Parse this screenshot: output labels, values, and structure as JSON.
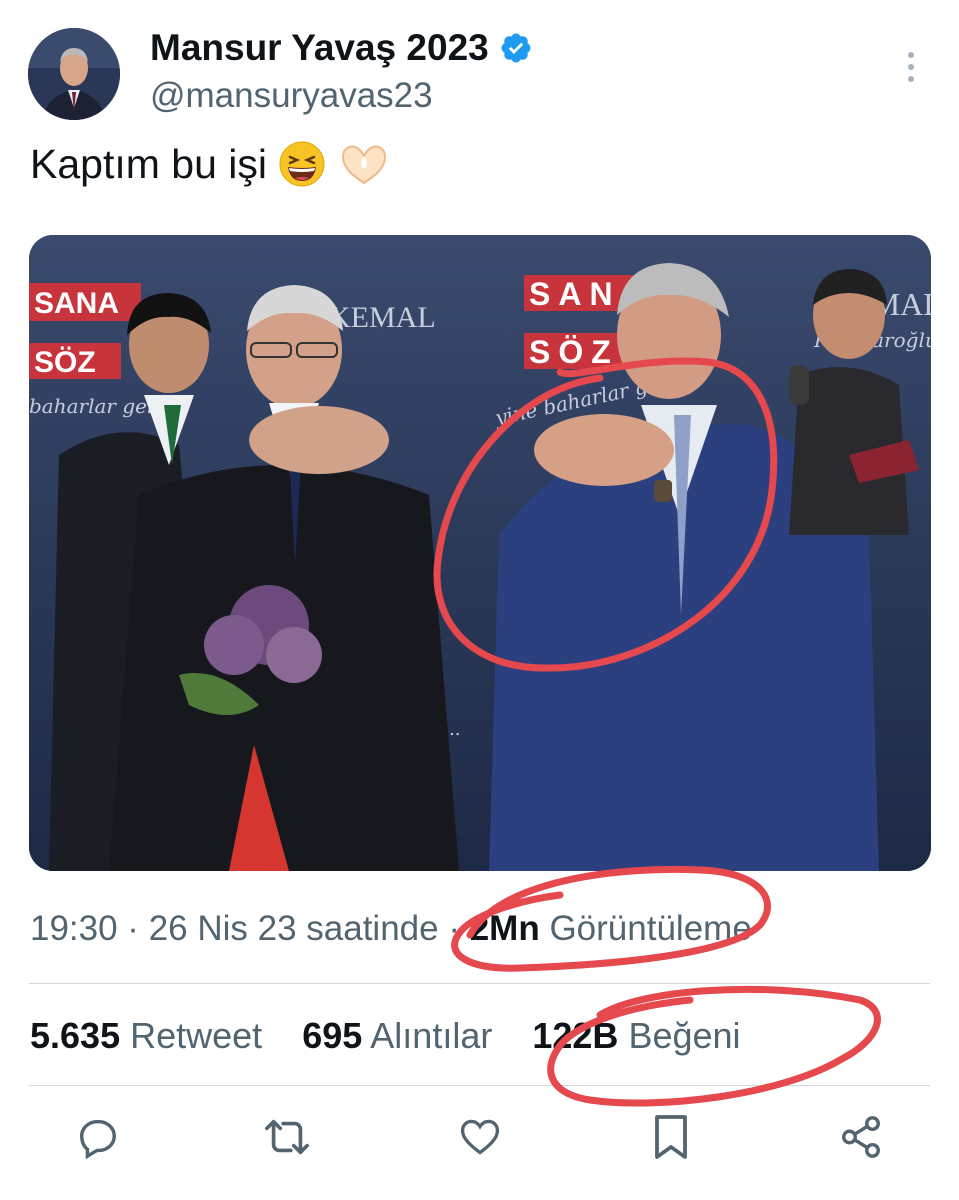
{
  "tweet": {
    "display_name": "Mansur Yavaş 2023",
    "handle": "@mansuryavas23",
    "verified": true,
    "text": "Kaptım bu işi",
    "emojis": [
      "grinning-squinting-face",
      "heart-hands"
    ]
  },
  "media": {
    "banner_lines": [
      "SANA",
      "SÖZ"
    ],
    "signature": "KEMAL",
    "signature_script": "Kılıçdaroğlu",
    "slogan_left": "baharlar gel",
    "slogan_right": "yine baharlar g",
    "slogan_bottom": "ecek..."
  },
  "meta": {
    "time_date": "19:30 · 26 Nis 23 saatinde ·",
    "views_count": "2Mn",
    "views_label": "Görüntüleme"
  },
  "stats": {
    "retweets_count": "5.635",
    "retweets_label": "Retweet",
    "quotes_count": "695",
    "quotes_label": "Alıntılar",
    "likes_count": "122B",
    "likes_label": "Beğeni"
  },
  "actions": [
    "reply-icon",
    "retweet-icon",
    "like-icon",
    "bookmark-icon",
    "share-icon"
  ],
  "colors": {
    "verified": "#1d9bf0",
    "secondary_text": "#536471",
    "annotation": "#e5484d"
  }
}
